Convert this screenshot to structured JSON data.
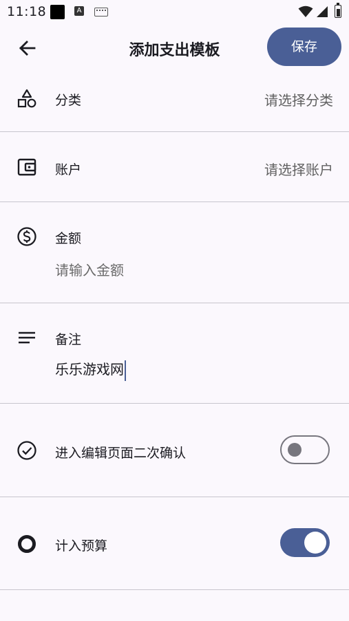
{
  "status_bar": {
    "time": "11:18"
  },
  "app_bar": {
    "title": "添加支出模板",
    "save_label": "保存"
  },
  "form": {
    "category": {
      "label": "分类",
      "value": "请选择分类"
    },
    "account": {
      "label": "账户",
      "value": "请选择账户"
    },
    "amount": {
      "label": "金额",
      "placeholder": "请输入金额"
    },
    "note": {
      "label": "备注",
      "value": "乐乐游戏网"
    },
    "confirm_edit": {
      "label": "进入编辑页面二次确认",
      "enabled": false
    },
    "budget": {
      "label": "计入预算",
      "enabled": true
    }
  },
  "colors": {
    "accent": "#4a5f96",
    "background": "#fbf8fd",
    "divider": "#c7c5cd"
  }
}
